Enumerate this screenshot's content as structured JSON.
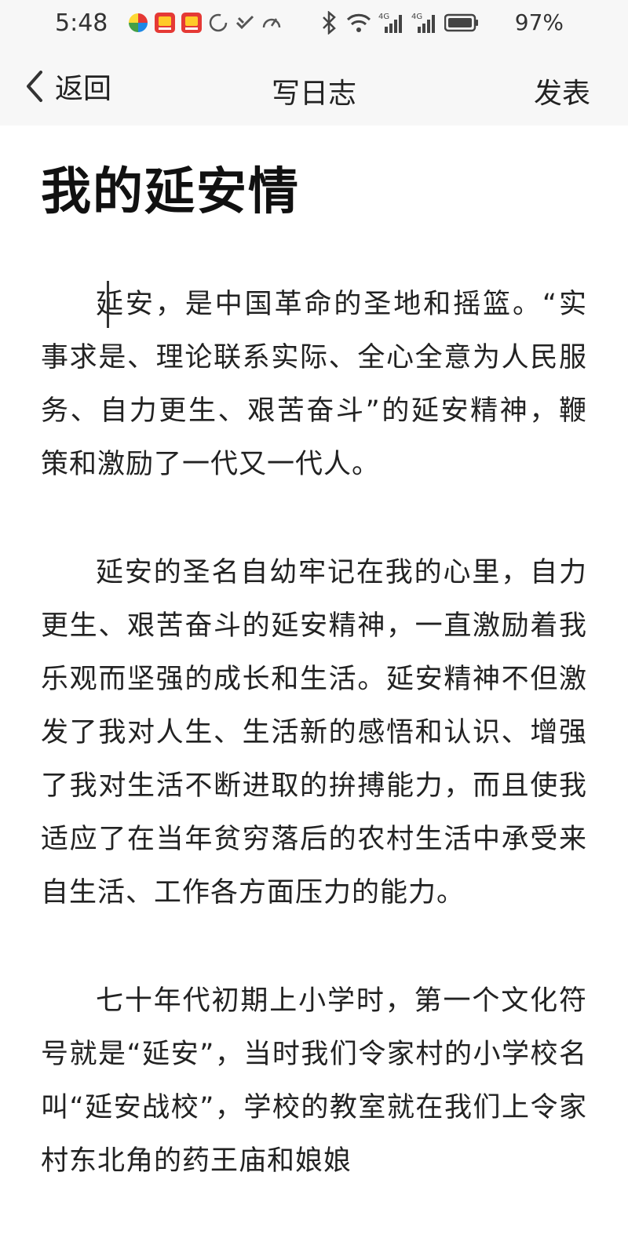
{
  "status_bar": {
    "time": "5:48",
    "battery": "97%",
    "network_label": "4G"
  },
  "nav": {
    "back_label": "返回",
    "title": "写日志",
    "publish_label": "发表"
  },
  "article": {
    "title": "我的延安情",
    "paragraphs": [
      "延安，是中国革命的圣地和摇篮。“实事求是、理论联系实际、全心全意为人民服务、自力更生、艰苦奋斗”的延安精神，鞭策和激励了一代又一代人。",
      "延安的圣名自幼牢记在我的心里，自力更生、艰苦奋斗的延安精神，一直激励着我乐观而坚强的成长和生活。延安精神不但激发了我对人生、生活新的感悟和认识、增强了我对生活不断进取的拚搏能力，而且使我适应了在当年贫穷落后的农村生活中承受来自生活、工作各方面压力的能力。",
      "七十年代初期上小学时，第一个文化符号就是“延安”，当时我们令家村的小学校名叫“延安战校”，学校的教室就在我们上令家村东北角的药王庙和娘娘"
    ]
  },
  "colors": {
    "bar_background": "#f7f7f7",
    "text": "#222222"
  }
}
